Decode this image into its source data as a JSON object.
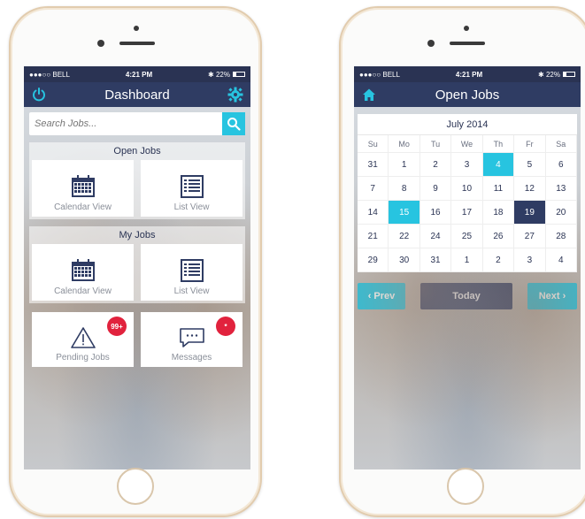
{
  "dashboard": {
    "status": {
      "carrier": "●●●○○ BELL",
      "time": "4:21 PM",
      "battery": "22%"
    },
    "title": "Dashboard",
    "search_placeholder": "Search Jobs...",
    "open_jobs": {
      "title": "Open Jobs",
      "calendar_label": "Calendar View",
      "list_label": "List View"
    },
    "my_jobs": {
      "title": "My Jobs",
      "calendar_label": "Calendar View",
      "list_label": "List View"
    },
    "pending": {
      "label": "Pending Jobs",
      "badge": "99+"
    },
    "messages": {
      "label": "Messages",
      "badge": "*"
    }
  },
  "open_jobs_screen": {
    "status": {
      "carrier": "●●●○○ BELL",
      "time": "4:21 PM",
      "battery": "22%"
    },
    "title": "Open Jobs",
    "month": "July 2014",
    "weekdays": [
      "Su",
      "Mo",
      "Tu",
      "We",
      "Th",
      "Fr",
      "Sa"
    ],
    "days": [
      "31",
      "1",
      "2",
      "3",
      "4",
      "5",
      "6",
      "7",
      "8",
      "9",
      "10",
      "11",
      "12",
      "13",
      "14",
      "15",
      "16",
      "17",
      "18",
      "19",
      "20",
      "21",
      "22",
      "24",
      "25",
      "26",
      "27",
      "28",
      "29",
      "30",
      "31",
      "1",
      "2",
      "3",
      "4"
    ],
    "highlighted_teal": [
      "4",
      "15"
    ],
    "highlighted_navy": [
      "19"
    ],
    "buttons": {
      "prev": "‹ Prev",
      "today": "Today",
      "next": "Next ›"
    }
  },
  "colors": {
    "navy": "#2f3c63",
    "teal": "#27c4e0",
    "badge_red": "#e1223d"
  }
}
